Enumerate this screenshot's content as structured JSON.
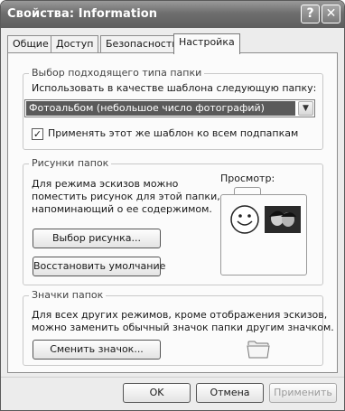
{
  "window": {
    "title": "Свойства: Information"
  },
  "titlebar": {
    "help_glyph": "?",
    "close_glyph": "✕"
  },
  "tabs": [
    {
      "label": "Общие"
    },
    {
      "label": "Доступ"
    },
    {
      "label": "Безопасность"
    },
    {
      "label": "Настройка"
    }
  ],
  "active_tab": "Настройка",
  "folder_type": {
    "group_title": "Выбор подходящего типа папки",
    "use_as_template_label": "Использовать в качестве шаблона следующую папку:",
    "template_value": "Фотоальбом (небольшое число фотографий)",
    "apply_to_subfolders": {
      "checked": true,
      "label": "Применять этот же шаблон ко всем подпапкам"
    }
  },
  "folder_pictures": {
    "group_title": "Рисунки папок",
    "description_line1": "Для режима эскизов можно",
    "description_line2": "поместить рисунок для этой папки,",
    "description_line3": "напоминающий о ее содержимом.",
    "choose_picture_button": "Выбор рисунка...",
    "restore_default_button": "Восстановить умолчание",
    "preview_label": "Просмотр:"
  },
  "folder_icons": {
    "group_title": "Значки папок",
    "description_line1": "Для всех других режимов, кроме отображения эскизов,",
    "description_line2": "можно заменить обычный значок папки другим значком.",
    "change_icon_button": "Сменить значок..."
  },
  "footer": {
    "ok_button": "OK",
    "cancel_button": "Отмена",
    "apply_button": "Применить"
  }
}
